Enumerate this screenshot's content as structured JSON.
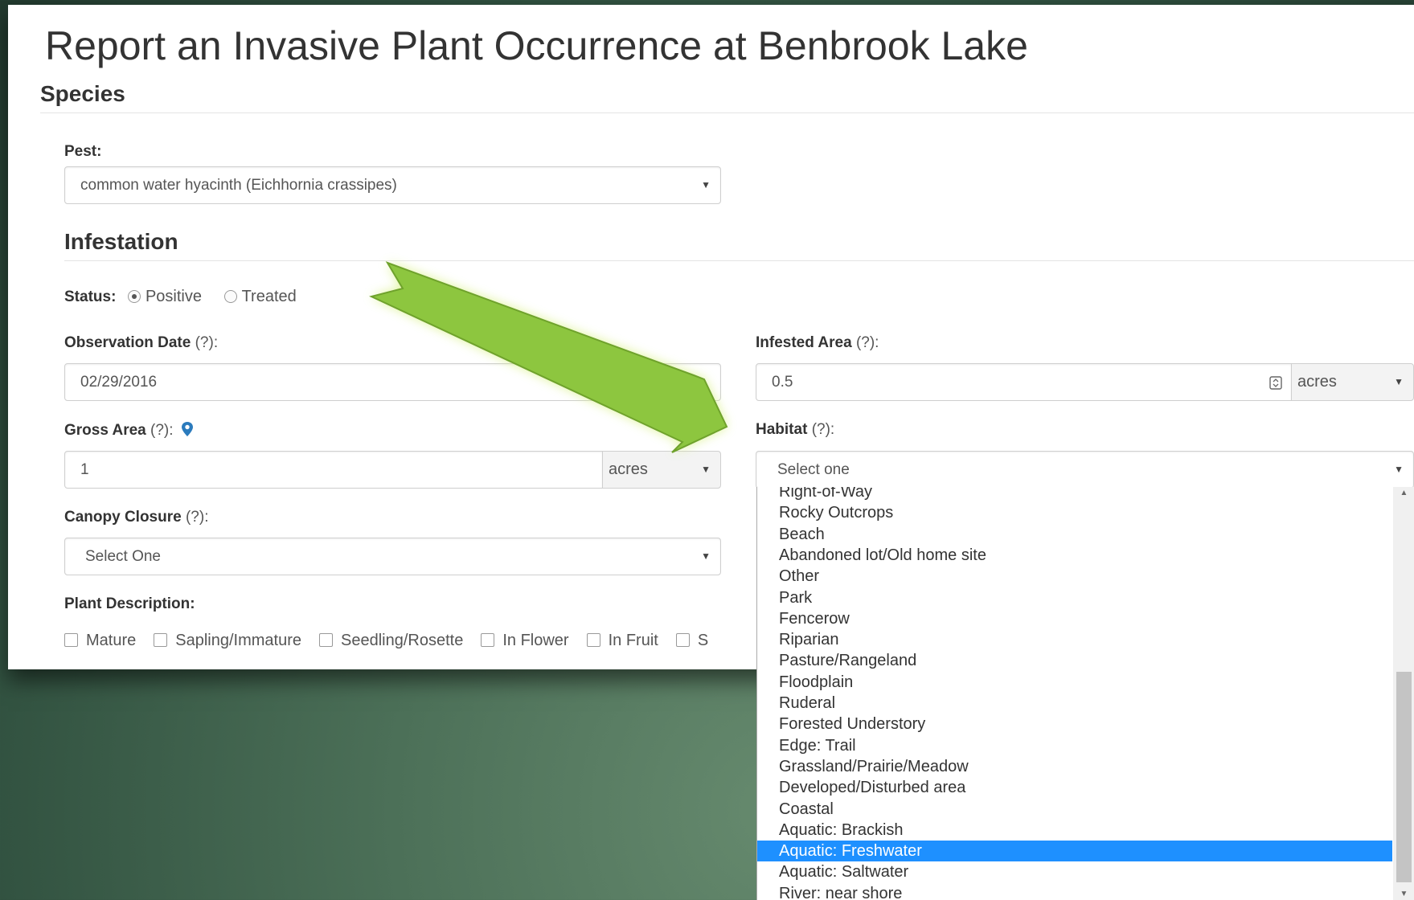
{
  "page": {
    "title": "Report an Invasive Plant Occurrence at Benbrook Lake"
  },
  "species": {
    "heading": "Species",
    "pest_label": "Pest:",
    "pest_value": "common water hyacinth (Eichhornia crassipes)"
  },
  "infestation": {
    "heading": "Infestation",
    "status_label": "Status:",
    "status_options": [
      "Positive",
      "Treated"
    ],
    "status_selected": "Positive",
    "observation_date_label": "Observation Date",
    "observation_date_value": "02/29/2016",
    "infested_area_label": "Infested Area",
    "infested_area_value": "0.5",
    "infested_area_unit": "acres",
    "gross_area_label": "Gross Area",
    "gross_area_value": "1",
    "gross_area_unit": "acres",
    "habitat_label": "Habitat",
    "habitat_value": "Select one",
    "canopy_label": "Canopy Closure",
    "canopy_value": "Select One",
    "help_marker": "(?):",
    "plant_description_label": "Plant Description:",
    "plant_description_options": [
      "Mature",
      "Sapling/Immature",
      "Seedling/Rosette",
      "In Flower",
      "In Fruit",
      "S"
    ]
  },
  "habitat_dropdown": {
    "options": [
      "Right-of-Way",
      "Rocky Outcrops",
      "Beach",
      "Abandoned lot/Old home site",
      "Other",
      "Park",
      "Fencerow",
      "Riparian",
      "Pasture/Rangeland",
      "Floodplain",
      "Ruderal",
      "Forested Understory",
      "Edge: Trail",
      "Grassland/Prairie/Meadow",
      "Developed/Disturbed area",
      "Coastal",
      "Aquatic: Brackish",
      "Aquatic: Freshwater",
      "Aquatic: Saltwater",
      "River: near shore"
    ],
    "highlighted": "Aquatic: Freshwater",
    "highlight_color": "#1e90ff"
  },
  "icons": {
    "map_pin": "map-pin-icon",
    "spinner": "number-spinner-icon",
    "caret": "caret-down-icon"
  },
  "colors": {
    "arrow": "#8dc63f",
    "pin": "#2b7bbd"
  }
}
